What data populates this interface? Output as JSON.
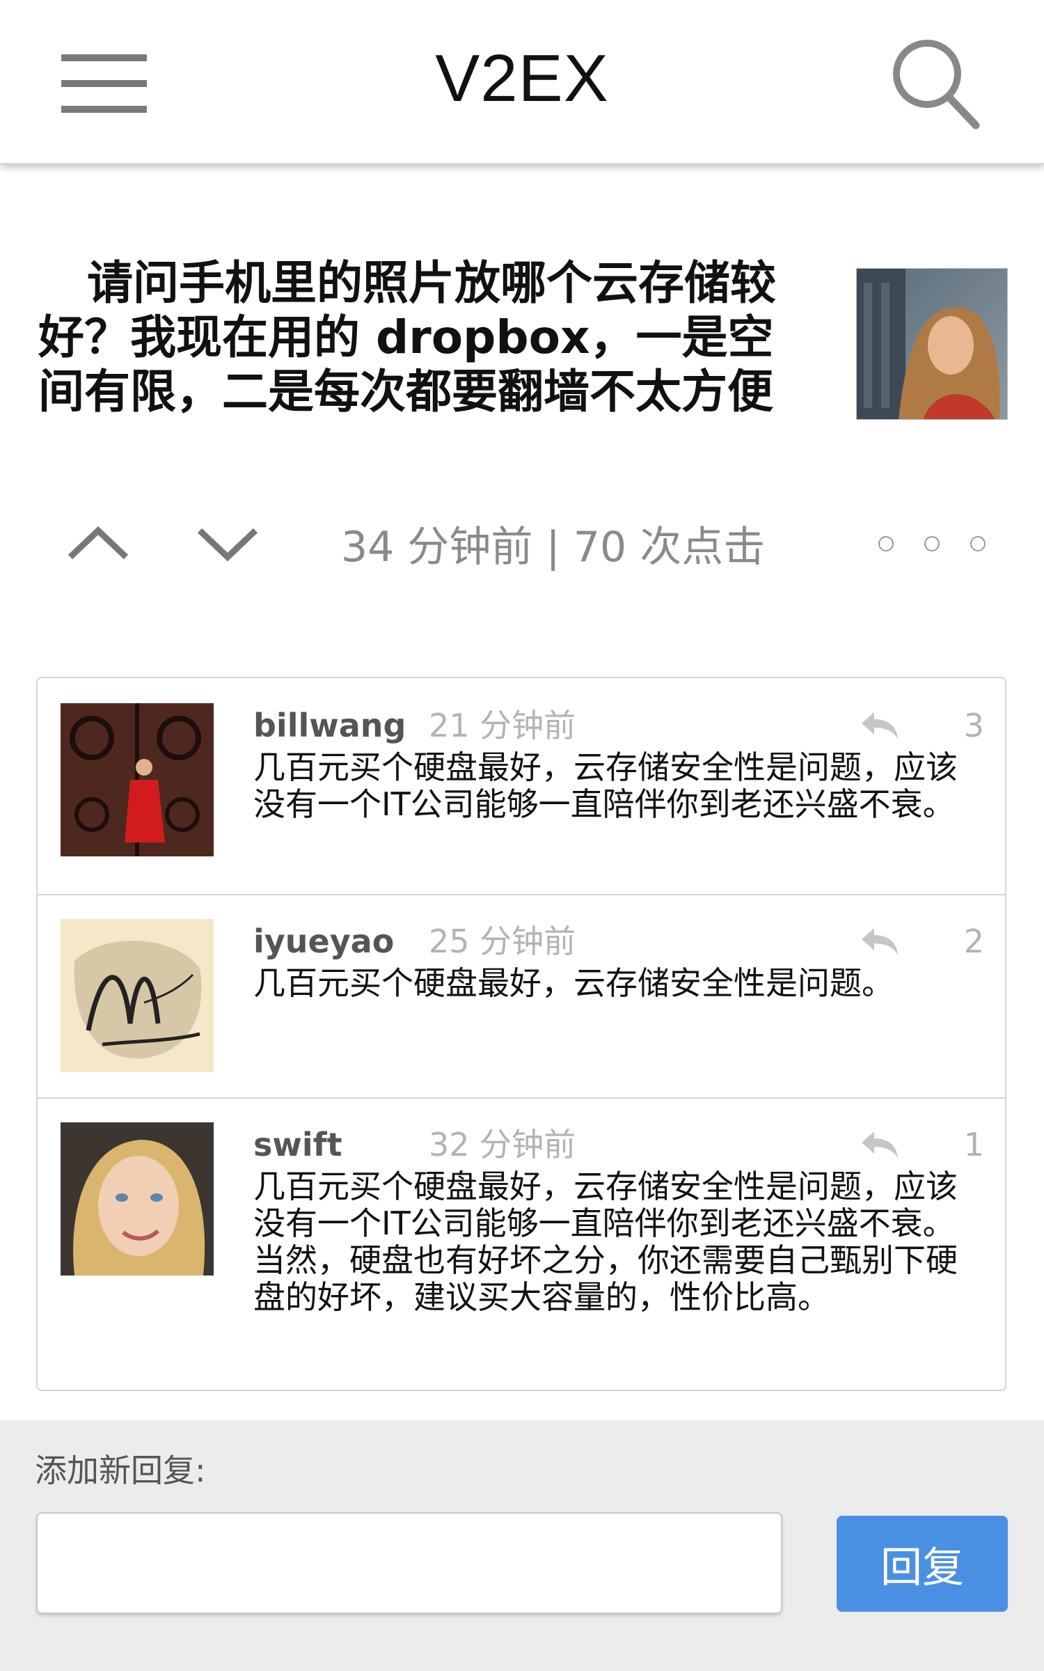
{
  "header": {
    "brand": "V2EX",
    "menu_icon": "hamburger-menu-icon",
    "search_icon": "search-icon"
  },
  "topic": {
    "title": "请问手机里的照片放哪个云存储较好？我现在用的 dropbox，一是空间有限，二是每次都要翻墙不太方便",
    "meta": "34 分钟前 | 70 次点击"
  },
  "replies": [
    {
      "username": "billwang",
      "time": "21 分钟前",
      "floor": "3",
      "content": "几百元买个硬盘最好，云存储安全性是问题，应该没有一个IT公司能够一直陪伴你到老还兴盛不衰。"
    },
    {
      "username": "iyueyao",
      "time": "25 分钟前",
      "floor": "2",
      "content": "几百元买个硬盘最好，云存储安全性是问题。"
    },
    {
      "username": "swift",
      "time": "32 分钟前",
      "floor": "1",
      "content": "几百元买个硬盘最好，云存储安全性是问题，应该没有一个IT公司能够一直陪伴你到老还兴盛不衰。当然，硬盘也有好坏之分，你还需要自己甄别下硬盘的好坏，建议买大容量的，性价比高。"
    }
  ],
  "new_reply": {
    "label": "添加新回复:",
    "input_value": "",
    "button_label": "回复"
  },
  "colors": {
    "accent": "#4a90e2",
    "muted_text": "#b3b3b3",
    "footer_bg": "#ececec"
  }
}
